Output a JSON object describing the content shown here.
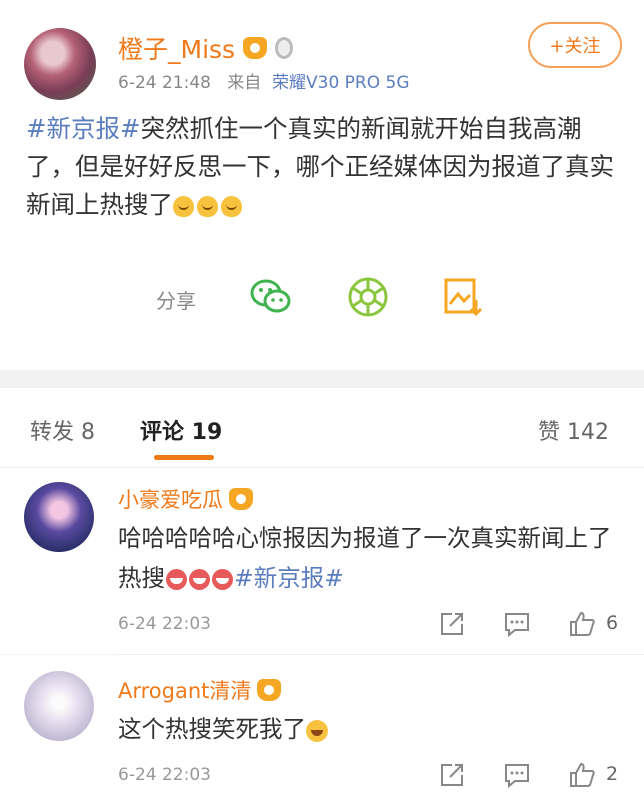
{
  "post": {
    "username": "橙子_Miss",
    "time": "6-24 21:48",
    "source_prefix": "来自",
    "device": "荣耀V30 PRO 5G",
    "follow_label": "+关注",
    "hashtag": "#新京报#",
    "text": "突然抓住一个真实的新闻就开始自我高潮了，但是好好反思一下，哪个正经媒体因为报道了真实新闻上热搜了",
    "share_label": "分享"
  },
  "tabs": {
    "repost": "转发 8",
    "comments": "评论 19",
    "likes": "赞 142"
  },
  "comments": [
    {
      "username": "小豪爱吃瓜",
      "text": "哈哈哈哈哈心惊报因为报道了一次真实新闻上了热搜",
      "hashtag": "#新京报#",
      "time": "6-24 22:03",
      "likes": "6"
    },
    {
      "username": "Arrogant清清",
      "text": "这个热搜笑死我了",
      "time": "6-24 22:03",
      "likes": "2"
    }
  ],
  "colors": {
    "accent": "#f07a1a",
    "link": "#5b7dbf",
    "wechat": "#3fb34f",
    "moments": "#8cc63f",
    "save": "#f5a623"
  }
}
